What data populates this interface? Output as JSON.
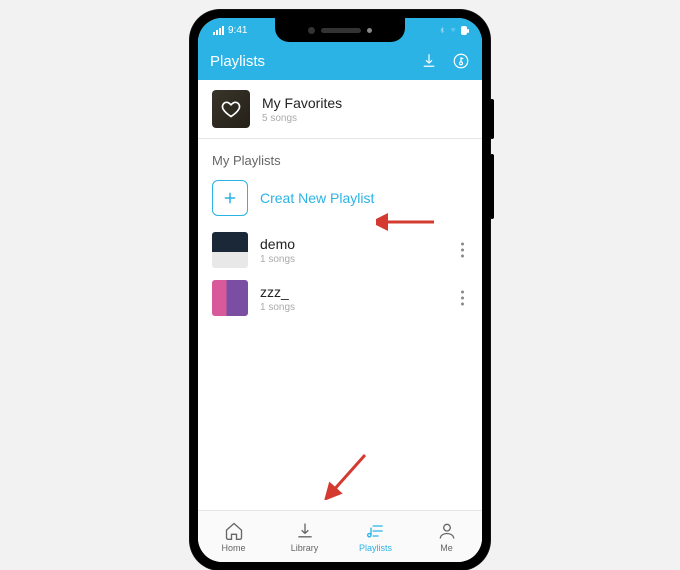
{
  "status": {
    "time": "9:41"
  },
  "header": {
    "title": "Playlists"
  },
  "favorites": {
    "title": "My Favorites",
    "sub": "5 songs"
  },
  "section": {
    "my_playlists": "My Playlists"
  },
  "create": {
    "label": "Creat New Playlist"
  },
  "playlists": [
    {
      "title": "demo",
      "sub": "1 songs"
    },
    {
      "title": "zzz_",
      "sub": "1 songs"
    }
  ],
  "nav": {
    "home": "Home",
    "library": "Library",
    "playlists": "Playlists",
    "me": "Me"
  }
}
